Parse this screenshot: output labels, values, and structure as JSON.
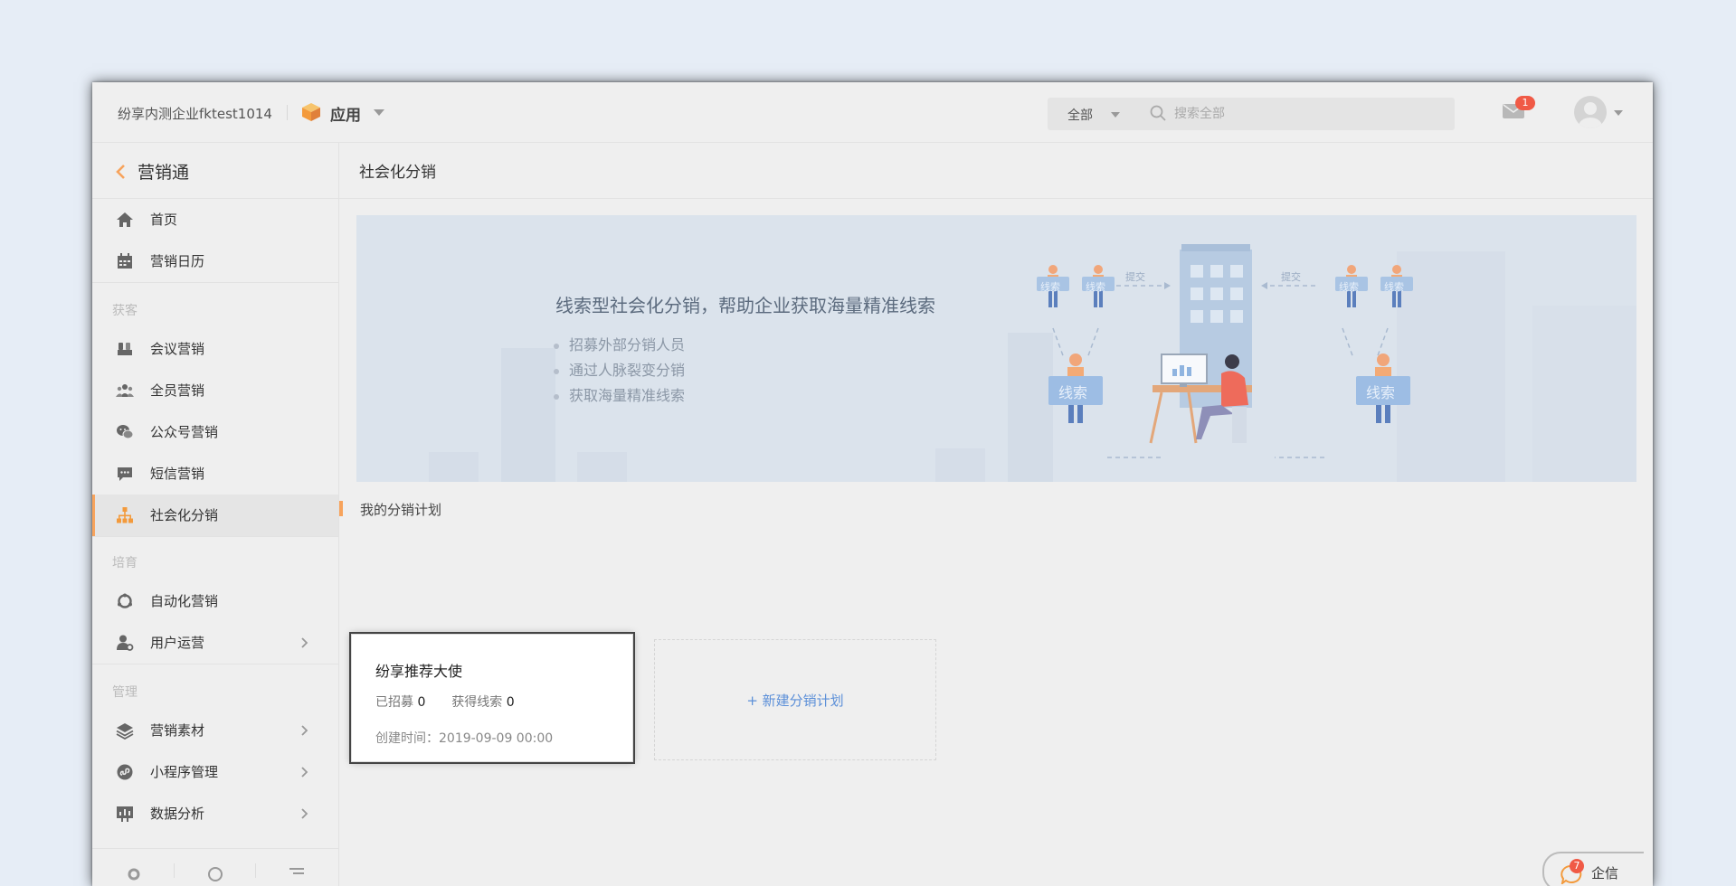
{
  "header": {
    "company": "纷享内测企业fktest1014",
    "app_label": "应用",
    "search_scope": "全部",
    "search_placeholder": "搜索全部",
    "mail_badge": "1"
  },
  "sidebar": {
    "back_title": "营销通",
    "groups": {
      "acquire": "获客",
      "nurture": "培育",
      "manage": "管理"
    },
    "items": {
      "home": "首页",
      "calendar": "营销日历",
      "meeting": "会议营销",
      "staff": "全员营销",
      "official": "公众号营销",
      "sms": "短信营销",
      "social": "社会化分销",
      "automation": "自动化营销",
      "user_ops": "用户运营",
      "materials": "营销素材",
      "miniprogram": "小程序管理",
      "analytics": "数据分析"
    }
  },
  "main": {
    "page_title": "社会化分销",
    "banner": {
      "title": "线索型社会化分销，帮助企业获取海量精准线索",
      "bullets": [
        "招募外部分销人员",
        "通过人脉裂变分销",
        "获取海量精准线索"
      ],
      "illustration": {
        "tag": "线索",
        "submit": "提交"
      }
    },
    "section_title": "我的分销计划",
    "plan": {
      "name": "纷享推荐大使",
      "recruited_label": "已招募",
      "recruited_value": "0",
      "leads_label": "获得线索",
      "leads_value": "0",
      "created_label": "创建时间：",
      "created_value": "2019-09-09 00:00"
    },
    "new_plan": "+ 新建分销计划"
  },
  "qixin": {
    "label": "企信",
    "badge": "7"
  },
  "colors": {
    "accent": "#f7a35c",
    "link": "#5b8fd8",
    "badge": "#f05a46"
  }
}
